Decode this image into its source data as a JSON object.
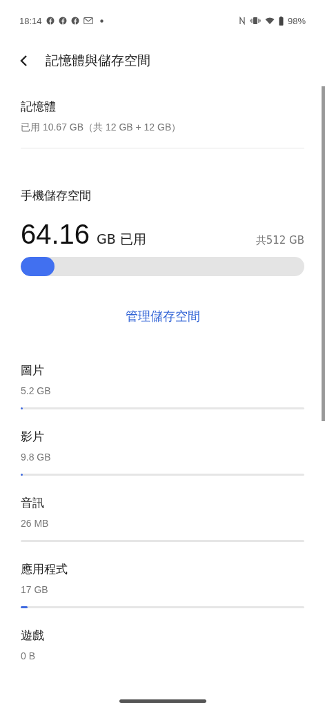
{
  "status_bar": {
    "time": "18:14",
    "battery": "98%"
  },
  "header": {
    "title": "記憶體與儲存空間"
  },
  "memory": {
    "title": "記憶體",
    "summary": "已用 10.67 GB（共 12 GB + 12 GB）"
  },
  "storage": {
    "title": "手機儲存空間",
    "used_value": "64.16",
    "used_unit": "GB 已用",
    "total": "共512 GB",
    "level": 0.12,
    "manage_link": "管理儲存空間"
  },
  "categories": [
    {
      "name": "圖片",
      "size": "5.2 GB",
      "bar": true,
      "level": 0.006
    },
    {
      "name": "影片",
      "size": "9.8 GB",
      "bar": true,
      "level": 0.006
    },
    {
      "name": "音訊",
      "size": "26 MB",
      "bar": true
    },
    {
      "name": "應用程式",
      "size": "17 GB",
      "bar": true,
      "level": 0.025
    },
    {
      "name": "遊戲",
      "size": "0 B",
      "bar": false
    }
  ]
}
